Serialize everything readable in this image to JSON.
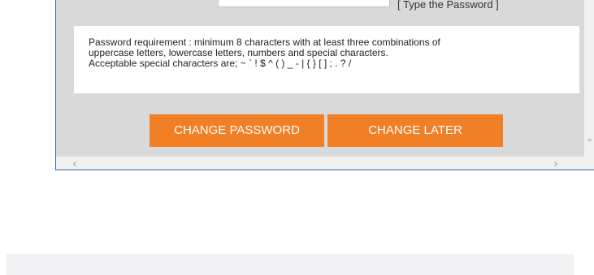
{
  "password_hint": "[ Type the Password ]",
  "requirements": {
    "line1": "Password requirement : minimum 8 characters with at least three combinations of",
    "line2": "uppercase letters, lowercase letters, numbers and special characters.",
    "line3": "Acceptable special characters are; ~ ` ! $ ^ ( ) _ - | { } [ ] ; . ? /"
  },
  "buttons": {
    "change_password": "CHANGE PASSWORD",
    "change_later": "CHANGE LATER"
  },
  "colors": {
    "accent_orange": "#f07f25",
    "content_gray": "#d9d9d9",
    "window_border_blue": "#2b6cb8"
  },
  "icons": {
    "scroll_down": "chevron-down-icon",
    "scroll_left": "chevron-left-icon",
    "scroll_right": "chevron-right-icon"
  }
}
